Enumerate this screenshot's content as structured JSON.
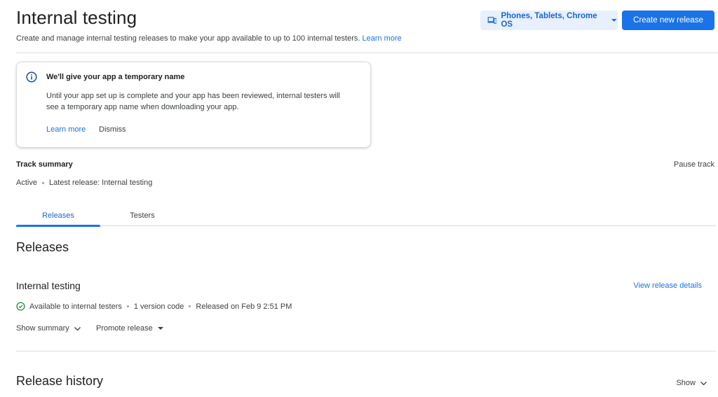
{
  "header": {
    "title": "Internal testing",
    "description": "Create and manage internal testing releases to make your app available to up to 100 internal testers.",
    "learn_more": "Learn more",
    "device_selector": "Phones, Tablets, Chrome OS",
    "create_button": "Create new release"
  },
  "info_card": {
    "title": "We'll give your app a temporary name",
    "body": "Until your app set up is complete and your app has been reviewed, internal testers will see a temporary app name when downloading your app.",
    "learn_more": "Learn more",
    "dismiss": "Dismiss"
  },
  "track": {
    "summary_label": "Track summary",
    "pause_label": "Pause track",
    "status": "Active",
    "latest_release": "Latest release: Internal testing"
  },
  "tabs": [
    {
      "label": "Releases",
      "active": true
    },
    {
      "label": "Testers",
      "active": false
    }
  ],
  "releases": {
    "section_title": "Releases",
    "release_name": "Internal testing",
    "view_details": "View release details",
    "availability": "Available to internal testers",
    "version_codes": "1 version code",
    "released_on": "Released on Feb 9 2:51 PM",
    "show_summary": "Show summary",
    "promote_release": "Promote release"
  },
  "history": {
    "section_title": "Release history",
    "show_label": "Show"
  },
  "colors": {
    "primary": "#1a73e8",
    "primary_light": "#e8f0fe",
    "success": "#1e8e3e",
    "text": "#202124",
    "text_secondary": "#3c4043",
    "divider": "#dadce0"
  },
  "icons": {
    "device": "devices-icon",
    "info": "info-icon",
    "check": "check-circle-icon",
    "chevron": "chevron-down-icon",
    "caret": "caret-down-icon"
  }
}
